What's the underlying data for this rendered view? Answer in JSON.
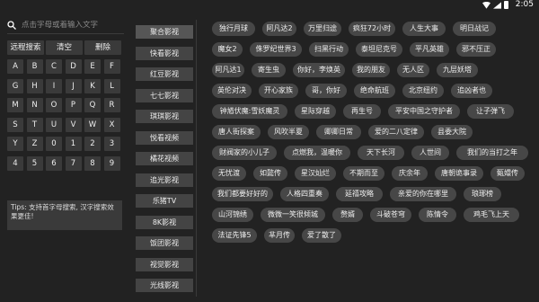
{
  "status": {
    "time": "2:05"
  },
  "search": {
    "placeholder": "点击字母或着输入文字"
  },
  "keypad": {
    "remote_search": "远程搜索",
    "clear": "清空",
    "delete": "删除",
    "keys": [
      "A",
      "B",
      "C",
      "D",
      "E",
      "F",
      "G",
      "H",
      "I",
      "J",
      "K",
      "L",
      "M",
      "N",
      "O",
      "P",
      "Q",
      "R",
      "S",
      "T",
      "U",
      "V",
      "W",
      "X",
      "Y",
      "Z",
      "0",
      "1",
      "2",
      "3",
      "4",
      "5",
      "6",
      "7",
      "8",
      "9"
    ]
  },
  "tips": "Tips: 支持首字母搜索, 汉字搜索效果更佳!",
  "sources": [
    "聚合影视",
    "快看影视",
    "红豆影视",
    "七七影视",
    "琪琪影视",
    "悦看视频",
    "橘花视频",
    "追光影视",
    "乐猪TV",
    "8K影视",
    "饭团影视",
    "视觉影视",
    "光线影视"
  ],
  "active_source": 0,
  "results": [
    "独行月球",
    "阿凡达2",
    "万里归途",
    "疯狂72小时",
    "人生大事",
    "明日战记",
    "魔女2",
    "侏罗纪世界3",
    "扫黑行动",
    "泰坦尼克号",
    "平凡英雄",
    "邪不压正",
    "阿凡达1",
    "寄生虫",
    "你好，李焕英",
    "我的朋友",
    "无人区",
    "九层妖塔",
    "英伦对决",
    "开心家族",
    "哥，你好",
    "绝命航班",
    "北京纽约",
    "追凶者也",
    "钟馗伏魔:雪妖魔灵",
    "星际穿越",
    "再生号",
    "平安中国之守护者",
    "让子弹飞",
    "唐人街探案",
    "风吹半夏",
    "卿卿日常",
    "爱的二八定律",
    "县委大院",
    "财阀家的小儿子",
    "点燃我，温暖你",
    "天下长河",
    "人世间",
    "我们的当打之年",
    "无忧渡",
    "如懿传",
    "星汉灿烂",
    "不期而至",
    "庆余年",
    "唐朝诡事录",
    "甄嬛传",
    "我们都要好好的",
    "人格四重奏",
    "延禧攻略",
    "亲爱的你在哪里",
    "琅琊榜",
    "山河锦绣",
    "微微一笑很倾城",
    "赘婿",
    "斗破苍穹",
    "陈情令",
    "鸡毛飞上天",
    "法证先锋5",
    "芈月传",
    "爱了散了"
  ]
}
